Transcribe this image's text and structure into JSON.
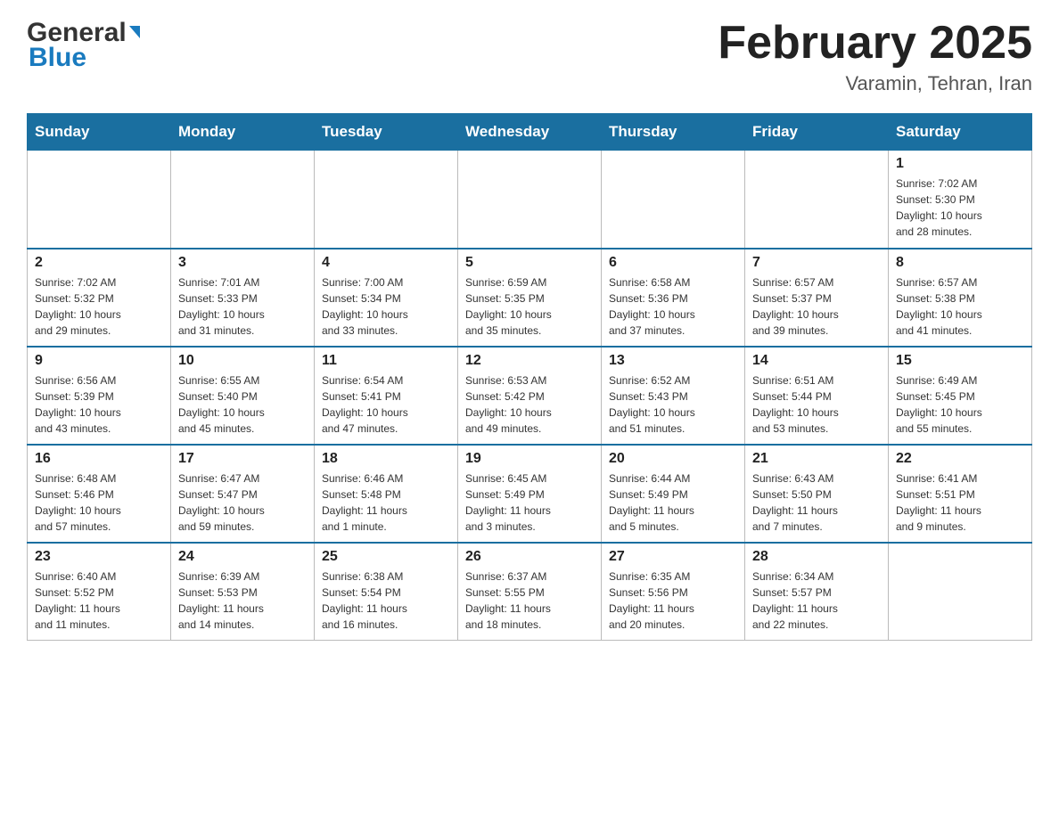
{
  "header": {
    "logo_general": "General",
    "logo_blue": "Blue",
    "month_title": "February 2025",
    "location": "Varamin, Tehran, Iran"
  },
  "days_of_week": [
    "Sunday",
    "Monday",
    "Tuesday",
    "Wednesday",
    "Thursday",
    "Friday",
    "Saturday"
  ],
  "weeks": [
    [
      {
        "day": "",
        "info": ""
      },
      {
        "day": "",
        "info": ""
      },
      {
        "day": "",
        "info": ""
      },
      {
        "day": "",
        "info": ""
      },
      {
        "day": "",
        "info": ""
      },
      {
        "day": "",
        "info": ""
      },
      {
        "day": "1",
        "info": "Sunrise: 7:02 AM\nSunset: 5:30 PM\nDaylight: 10 hours\nand 28 minutes."
      }
    ],
    [
      {
        "day": "2",
        "info": "Sunrise: 7:02 AM\nSunset: 5:32 PM\nDaylight: 10 hours\nand 29 minutes."
      },
      {
        "day": "3",
        "info": "Sunrise: 7:01 AM\nSunset: 5:33 PM\nDaylight: 10 hours\nand 31 minutes."
      },
      {
        "day": "4",
        "info": "Sunrise: 7:00 AM\nSunset: 5:34 PM\nDaylight: 10 hours\nand 33 minutes."
      },
      {
        "day": "5",
        "info": "Sunrise: 6:59 AM\nSunset: 5:35 PM\nDaylight: 10 hours\nand 35 minutes."
      },
      {
        "day": "6",
        "info": "Sunrise: 6:58 AM\nSunset: 5:36 PM\nDaylight: 10 hours\nand 37 minutes."
      },
      {
        "day": "7",
        "info": "Sunrise: 6:57 AM\nSunset: 5:37 PM\nDaylight: 10 hours\nand 39 minutes."
      },
      {
        "day": "8",
        "info": "Sunrise: 6:57 AM\nSunset: 5:38 PM\nDaylight: 10 hours\nand 41 minutes."
      }
    ],
    [
      {
        "day": "9",
        "info": "Sunrise: 6:56 AM\nSunset: 5:39 PM\nDaylight: 10 hours\nand 43 minutes."
      },
      {
        "day": "10",
        "info": "Sunrise: 6:55 AM\nSunset: 5:40 PM\nDaylight: 10 hours\nand 45 minutes."
      },
      {
        "day": "11",
        "info": "Sunrise: 6:54 AM\nSunset: 5:41 PM\nDaylight: 10 hours\nand 47 minutes."
      },
      {
        "day": "12",
        "info": "Sunrise: 6:53 AM\nSunset: 5:42 PM\nDaylight: 10 hours\nand 49 minutes."
      },
      {
        "day": "13",
        "info": "Sunrise: 6:52 AM\nSunset: 5:43 PM\nDaylight: 10 hours\nand 51 minutes."
      },
      {
        "day": "14",
        "info": "Sunrise: 6:51 AM\nSunset: 5:44 PM\nDaylight: 10 hours\nand 53 minutes."
      },
      {
        "day": "15",
        "info": "Sunrise: 6:49 AM\nSunset: 5:45 PM\nDaylight: 10 hours\nand 55 minutes."
      }
    ],
    [
      {
        "day": "16",
        "info": "Sunrise: 6:48 AM\nSunset: 5:46 PM\nDaylight: 10 hours\nand 57 minutes."
      },
      {
        "day": "17",
        "info": "Sunrise: 6:47 AM\nSunset: 5:47 PM\nDaylight: 10 hours\nand 59 minutes."
      },
      {
        "day": "18",
        "info": "Sunrise: 6:46 AM\nSunset: 5:48 PM\nDaylight: 11 hours\nand 1 minute."
      },
      {
        "day": "19",
        "info": "Sunrise: 6:45 AM\nSunset: 5:49 PM\nDaylight: 11 hours\nand 3 minutes."
      },
      {
        "day": "20",
        "info": "Sunrise: 6:44 AM\nSunset: 5:49 PM\nDaylight: 11 hours\nand 5 minutes."
      },
      {
        "day": "21",
        "info": "Sunrise: 6:43 AM\nSunset: 5:50 PM\nDaylight: 11 hours\nand 7 minutes."
      },
      {
        "day": "22",
        "info": "Sunrise: 6:41 AM\nSunset: 5:51 PM\nDaylight: 11 hours\nand 9 minutes."
      }
    ],
    [
      {
        "day": "23",
        "info": "Sunrise: 6:40 AM\nSunset: 5:52 PM\nDaylight: 11 hours\nand 11 minutes."
      },
      {
        "day": "24",
        "info": "Sunrise: 6:39 AM\nSunset: 5:53 PM\nDaylight: 11 hours\nand 14 minutes."
      },
      {
        "day": "25",
        "info": "Sunrise: 6:38 AM\nSunset: 5:54 PM\nDaylight: 11 hours\nand 16 minutes."
      },
      {
        "day": "26",
        "info": "Sunrise: 6:37 AM\nSunset: 5:55 PM\nDaylight: 11 hours\nand 18 minutes."
      },
      {
        "day": "27",
        "info": "Sunrise: 6:35 AM\nSunset: 5:56 PM\nDaylight: 11 hours\nand 20 minutes."
      },
      {
        "day": "28",
        "info": "Sunrise: 6:34 AM\nSunset: 5:57 PM\nDaylight: 11 hours\nand 22 minutes."
      },
      {
        "day": "",
        "info": ""
      }
    ]
  ]
}
